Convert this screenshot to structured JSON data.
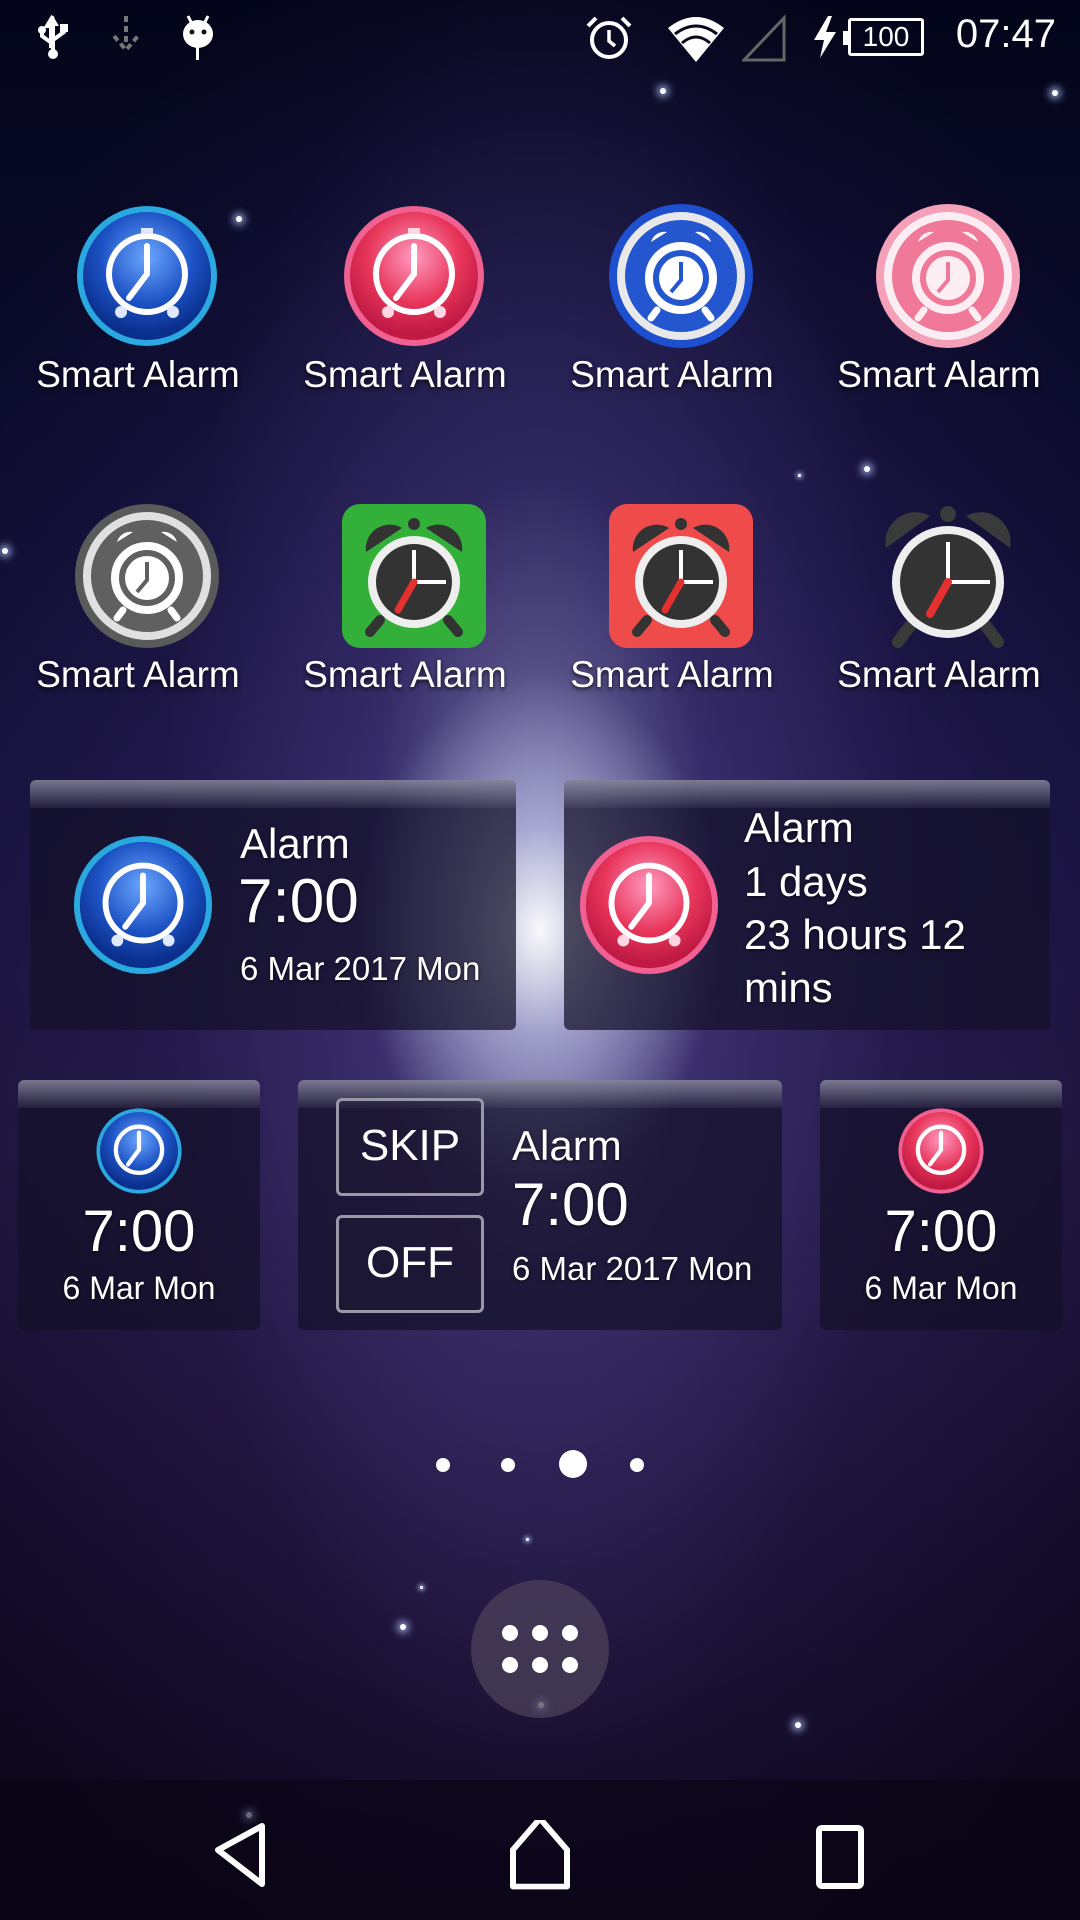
{
  "status_bar": {
    "left_icons": [
      "usb-icon",
      "download-icon",
      "android-debug-icon"
    ],
    "right_icons": [
      "alarm-icon",
      "wifi-icon",
      "cell-signal-icon",
      "charging-icon",
      "battery-icon"
    ],
    "battery_level": "100",
    "time": "07:47"
  },
  "home": {
    "apps": [
      {
        "label": "Smart Alarm",
        "icon": "blue-glossy-alarm-icon",
        "color": "#1e5bd6"
      },
      {
        "label": "Smart Alarm",
        "icon": "pink-glossy-alarm-icon",
        "color": "#e8355a"
      },
      {
        "label": "Smart Alarm",
        "icon": "blue-flat-alarm-icon",
        "color": "#2456d0"
      },
      {
        "label": "Smart Alarm",
        "icon": "pink-flat-alarm-icon",
        "color": "#f07898"
      },
      {
        "label": "Smart Alarm",
        "icon": "gray-flat-alarm-icon",
        "color": "#606060"
      },
      {
        "label": "Smart Alarm",
        "icon": "green-square-alarm-icon",
        "color": "#33b03a"
      },
      {
        "label": "Smart Alarm",
        "icon": "red-square-alarm-icon",
        "color": "#ef4b4b"
      },
      {
        "label": "Smart Alarm",
        "icon": "black-bell-alarm-icon",
        "color": "#3a3a3a"
      }
    ],
    "widgets": {
      "large_blue": {
        "title": "Alarm",
        "time": "7:00",
        "date": "6 Mar 2017 Mon"
      },
      "large_pink": {
        "title": "Alarm",
        "line1": "1 days",
        "line2": "23 hours 12",
        "line3": "mins"
      },
      "small_blue": {
        "time": "7:00",
        "date": "6 Mar Mon"
      },
      "skip_off": {
        "skip_label": "SKIP",
        "off_label": "OFF",
        "title": "Alarm",
        "time": "7:00",
        "date": "6 Mar 2017 Mon"
      },
      "small_pink": {
        "time": "7:00",
        "date": "6 Mar Mon"
      }
    },
    "page_indicator": {
      "pages": 4,
      "current": 3
    },
    "app_drawer_icon": "app-drawer-icon"
  },
  "nav_bar": {
    "buttons": [
      "back-icon",
      "home-icon",
      "recents-icon"
    ]
  }
}
